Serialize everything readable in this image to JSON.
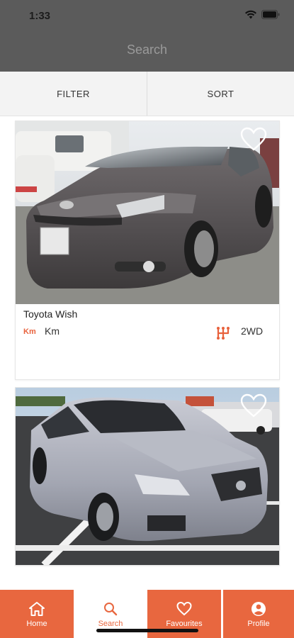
{
  "status_bar": {
    "time": "1:33"
  },
  "header": {
    "title": "Search"
  },
  "toolbar": {
    "filter_label": "FILTER",
    "sort_label": "SORT"
  },
  "listings": [
    {
      "name": "Toyota Wish",
      "km_icon": "Km",
      "km_value": "Km",
      "drive": "2WD",
      "favourite_icon": "heart-outline-icon",
      "drive_icon": "gear-shift-icon"
    },
    {
      "favourite_icon": "heart-outline-icon"
    }
  ],
  "tabbar": {
    "items": [
      {
        "label": "Home",
        "icon": "home-icon"
      },
      {
        "label": "Search",
        "icon": "search-icon"
      },
      {
        "label": "Favourites",
        "icon": "heart-icon"
      },
      {
        "label": "Profile",
        "icon": "profile-icon"
      }
    ],
    "active": "Search"
  },
  "colors": {
    "accent": "#e8673f",
    "header": "#5b5b5b",
    "toolbar": "#f3f3f3"
  }
}
